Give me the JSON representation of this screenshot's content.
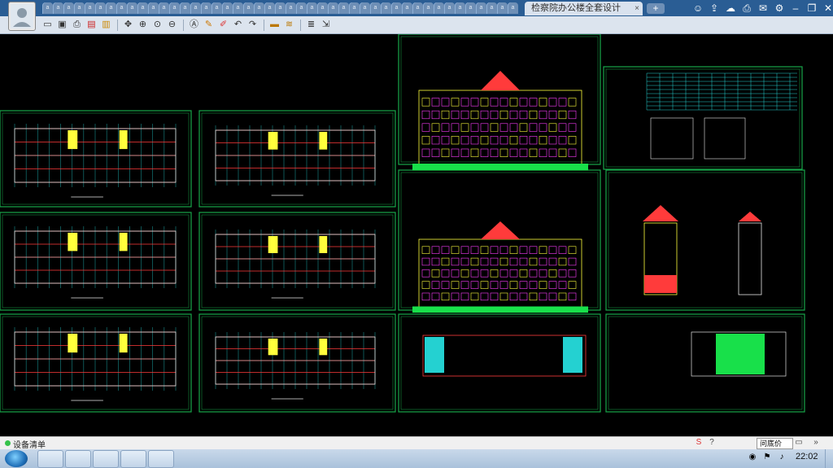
{
  "window": {
    "file_tab_title": "检察院办公楼全套设计图.dwg",
    "file_tab_close": "×",
    "new_tab": "+",
    "tab_count": 45,
    "tab_glyph": "a",
    "controls": [
      "user-group-icon",
      "share-icon",
      "cloud-icon",
      "print-icon",
      "mail-icon",
      "settings-icon",
      "minimize-icon",
      "restore-icon",
      "close-icon"
    ]
  },
  "toolbar": {
    "tools": [
      "open-icon",
      "save-icon",
      "print-icon",
      "pdf-icon",
      "lock-icon",
      "pan-icon",
      "zoom-in-icon",
      "zoom-window-icon",
      "zoom-out-icon",
      "text-icon",
      "pen-icon",
      "eraser-icon",
      "undo-icon",
      "redo-icon",
      "layer-icon",
      "measure-icon",
      "stack-icon",
      "export-icon"
    ]
  },
  "status": {
    "text": "设备清单",
    "question_box": "问底价"
  },
  "taskbar": {
    "clock": "22:02"
  },
  "colors": {
    "sheet_border": "#17a64a",
    "wall_red": "#ff3b3b",
    "grid_cyan": "#24d1d1",
    "yellow": "#ffff3c",
    "magenta": "#ff3dff",
    "green_fill": "#18e04a",
    "white_line": "#e6e6e6"
  }
}
